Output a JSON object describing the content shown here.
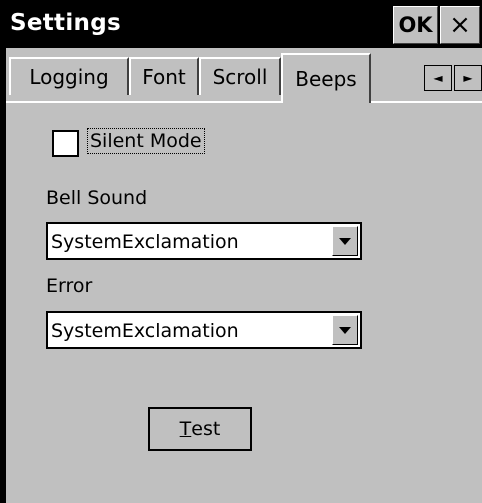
{
  "window": {
    "title": "Settings",
    "ok_label": "OK",
    "close_label": "×"
  },
  "tabs": [
    {
      "label": "Logging",
      "active": false
    },
    {
      "label": "Font",
      "active": false
    },
    {
      "label": "Scroll",
      "active": false
    },
    {
      "label": "Beeps",
      "active": true
    }
  ],
  "tab_scroll": {
    "left_icon": "◄",
    "right_icon": "►"
  },
  "beeps": {
    "silent_mode": {
      "label": "Silent Mode",
      "checked": false
    },
    "bell_sound": {
      "label": "Bell Sound",
      "value": "SystemExclamation"
    },
    "error": {
      "label": "Error",
      "value": "SystemExclamation"
    },
    "test_button": {
      "mnemonic": "T",
      "rest": "est"
    }
  }
}
